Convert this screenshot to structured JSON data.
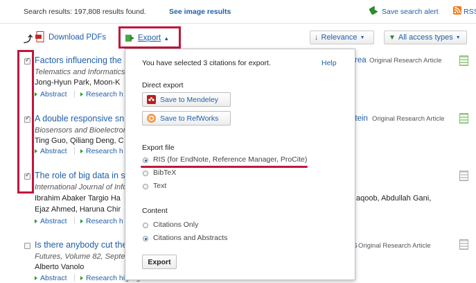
{
  "topbar": {
    "results_label": "Search results: 197,808 results found.",
    "see_image_results": "See image results",
    "save_alert": "Save search alert",
    "rss": "RSS"
  },
  "toolbar": {
    "download_pdfs": "Download PDFs",
    "export": "Export",
    "relevance": "Relevance",
    "access_types": "All access types"
  },
  "results": [
    {
      "title": "Factors influencing the",
      "title_tail": "rea",
      "type": "Original Research Article",
      "journal": "Telematics and Informatics,",
      "authors": "Jong-Hyun Park, Moon-K",
      "authors_tail": "",
      "authors2": "",
      "checked": true
    },
    {
      "title": "A double responsive sn",
      "title_tail": "otein",
      "type": "Original Research Article",
      "journal": "Biosensors and Bioelectroni",
      "authors": "Ting Guo, Qiliang Deng, C",
      "authors_tail": "",
      "authors2": "",
      "checked": true
    },
    {
      "title": "The role of big data in s",
      "title_tail": "",
      "type": "",
      "journal": "International Journal of Infor",
      "authors": "Ibrahim Abaker Targio Ha",
      "authors_tail": "aqoob, Abdullah Gani,",
      "authors2": "Ejaz Ahmed, Haruna Chir",
      "checked": true
    },
    {
      "title": "Is there anybody cut the",
      "title_tail": "s",
      "type": "Original Research Article",
      "journal": "Futures, Volume 82, Septem",
      "authors": "Alberto Vanolo",
      "authors_tail": "",
      "authors2": "",
      "checked": false
    }
  ],
  "row_links": {
    "abstract": "Abstract",
    "research": "Research h"
  },
  "last_row_research": "Research highlights",
  "dropdown": {
    "selected_msg": "You have selected 3 citations for export.",
    "help": "Help",
    "direct_export": "Direct export",
    "mendeley": "Save to Mendeley",
    "refworks": "Save to RefWorks",
    "export_file": "Export file",
    "formats": [
      {
        "label": "RIS (for EndNote, Reference Manager, ProCite)",
        "selected": true
      },
      {
        "label": "BibTeX",
        "selected": false
      },
      {
        "label": "Text",
        "selected": false
      }
    ],
    "content": "Content",
    "content_options": [
      {
        "label": "Citations Only",
        "selected": false
      },
      {
        "label": "Citations and Abstracts",
        "selected": true
      }
    ],
    "export_button": "Export"
  },
  "colors": {
    "link": "#1f5fa8",
    "highlight": "#c0163c",
    "accent_green": "#2e9a2e"
  }
}
